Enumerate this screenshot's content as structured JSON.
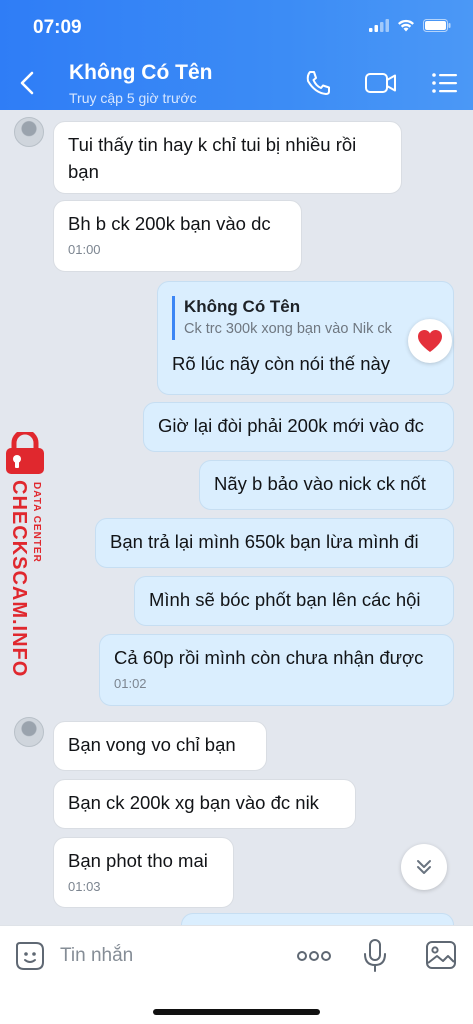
{
  "status": {
    "time": "07:09"
  },
  "header": {
    "title": "Không Có Tên",
    "subtitle": "Truy cập 5 giờ trước"
  },
  "messages": [
    {
      "side": "in",
      "text": "Tui thấy tin hay k chỉ tui bị nhiều rồi bạn"
    },
    {
      "side": "in",
      "text": "Bh b ck 200k bạn vào dc",
      "time": "01:00"
    },
    {
      "side": "out",
      "quote_name": "Không Có Tên",
      "quote_text": "Ck trc 300k xong bạn vào Nik ck",
      "text": "Rõ lúc nãy còn nói thế này",
      "reaction": "heart"
    },
    {
      "side": "out",
      "text": "Giờ lại đòi phải 200k mới vào đc"
    },
    {
      "side": "out",
      "text": "Nãy b bảo vào nick ck nốt"
    },
    {
      "side": "out",
      "text": "Bạn trả lại mình 650k bạn lừa mình đi"
    },
    {
      "side": "out",
      "text": "Mình sẽ bóc phốt bạn lên các hội"
    },
    {
      "side": "out",
      "text": "Cả 60p rồi mình còn chưa nhận được",
      "time": "01:02"
    },
    {
      "side": "in",
      "text": "Bạn vong vo chỉ bạn"
    },
    {
      "side": "in",
      "text": "Bạn ck 200k xg bạn vào đc nik"
    },
    {
      "side": "in",
      "text": "Bạn phot tho mai",
      "time": "01:03"
    }
  ],
  "watermark": {
    "main": "CHECKSCAM.INFO",
    "sub": "DATA CENTER"
  },
  "input": {
    "placeholder": "Tin nhắn"
  },
  "colors": {
    "header": "#3c8cf5",
    "outgoing": "#daeefe",
    "incoming": "#ffffff",
    "watermark": "#e0282e"
  }
}
